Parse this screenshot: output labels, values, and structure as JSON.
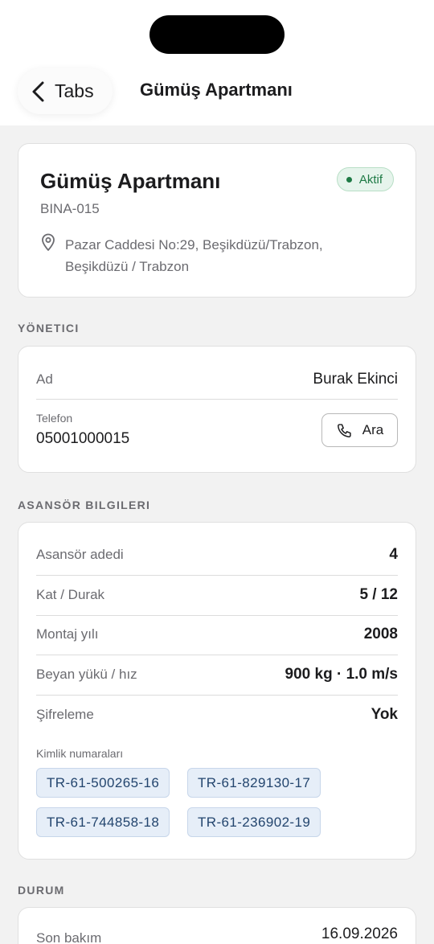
{
  "nav": {
    "back_label": "Tabs",
    "title": "Gümüş Apartmanı"
  },
  "building": {
    "name": "Gümüş Apartmanı",
    "status": "Aktif",
    "code": "BINA-015",
    "address_line1": "Pazar Caddesi No:29, Beşikdüzü/Trabzon,",
    "address_line2": "Beşikdüzü / Trabzon"
  },
  "manager": {
    "section_title": "YÖNETICI",
    "name_label": "Ad",
    "name_value": "Burak Ekinci",
    "phone_label": "Telefon",
    "phone_value": "05001000015",
    "call_label": "Ara"
  },
  "elevator": {
    "section_title": "ASANSÖR BILGILERI",
    "rows": [
      {
        "label": "Asansör adedi",
        "value": "4"
      },
      {
        "label": "Kat / Durak",
        "value": "5 / 12"
      },
      {
        "label": "Montaj yılı",
        "value": "2008"
      },
      {
        "label": "Beyan yükü / hız",
        "value": "900 kg · 1.0 m/s"
      },
      {
        "label": "Şifreleme",
        "value": "Yok"
      }
    ],
    "ids_label": "Kimlik numaraları",
    "ids": [
      "TR-61-500265-16",
      "TR-61-829130-17",
      "TR-61-744858-18",
      "TR-61-236902-19"
    ]
  },
  "status": {
    "section_title": "DURUM",
    "last_label": "Son bakım",
    "last_value": "16.09.2026"
  },
  "colors": {
    "accent_green": "#1e7a45",
    "chip_text": "#23456e",
    "chip_bg": "#e6eef8"
  },
  "icons": [
    "chevron-left-icon",
    "map-pin-icon",
    "phone-icon",
    "status-dot-icon"
  ]
}
